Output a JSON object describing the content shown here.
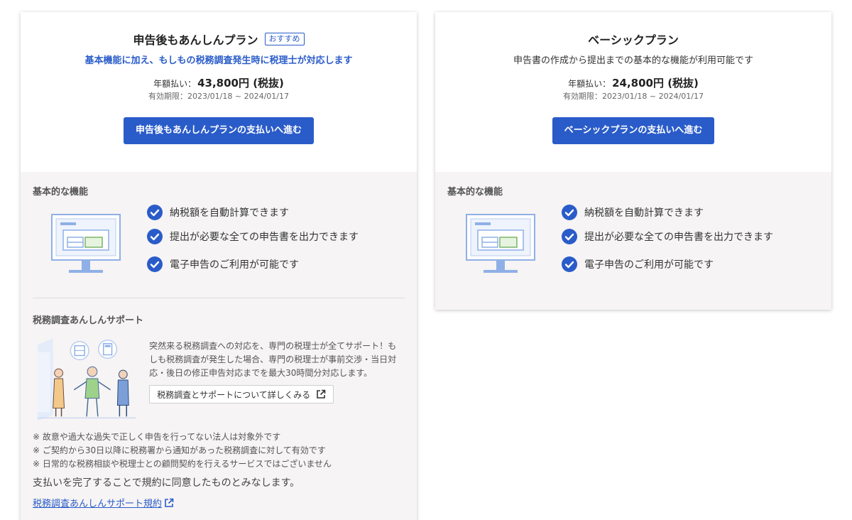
{
  "plans": [
    {
      "title": "申告後もあんしんプラン",
      "badge": "おすすめ",
      "tagline": "基本機能に加え、もしもの税務調査発生時に税理士が対応します",
      "price_label": "年額払い：",
      "price": "43,800円 (税抜)",
      "validity": "有効期限：2023/01/18 ~ 2024/01/17",
      "cta_label": "申告後もあんしんプランの支払いへ進む",
      "features_title": "基本的な機能",
      "features": [
        "納税額を自動計算できます",
        "提出が必要な全ての申告書を出力できます",
        "電子申告のご利用が可能です"
      ],
      "support": {
        "title": "税務調査あんしんサポート",
        "description": "突然来る税務調査への対応を、専門の税理士が全てサポート！もしも税務調査が発生した場合、専門の税理士が事前交渉・当日対応・後日の修正申告対応までを最大30時間分対応します。",
        "detail_button": "税務調査とサポートについて詳しくみる",
        "notes": [
          "※ 故意や過大な過失で正しく申告を行ってない法人は対象外です",
          "※ ご契約から30日以降に税務署から通知があった税務調査に対して有効です",
          "※ 日常的な税務相談や税理士との顧問契約を行えるサービスではございません"
        ],
        "agreement": "支払いを完了することで規約に同意したものとみなします。",
        "terms_link": "税務調査あんしんサポート規約"
      }
    },
    {
      "title": "ベーシックプラン",
      "tagline": "申告書の作成から提出までの基本的な機能が利用可能です",
      "price_label": "年額払い：",
      "price": "24,800円 (税抜)",
      "validity": "有効期限：2023/01/18 ~ 2024/01/17",
      "cta_label": "ベーシックプランの支払いへ進む",
      "features_title": "基本的な機能",
      "features": [
        "納税額を自動計算できます",
        "提出が必要な全ての申告書を出力できます",
        "電子申告のご利用が可能です"
      ]
    }
  ],
  "colors": {
    "accent": "#2a5cc9",
    "section_bg": "#f6f4f4",
    "illustration_line": "#8fb0e6"
  },
  "icons": {
    "check": "check-circle-icon",
    "external": "external-link-icon",
    "monitor": "monitor-illustration",
    "support": "support-illustration"
  }
}
